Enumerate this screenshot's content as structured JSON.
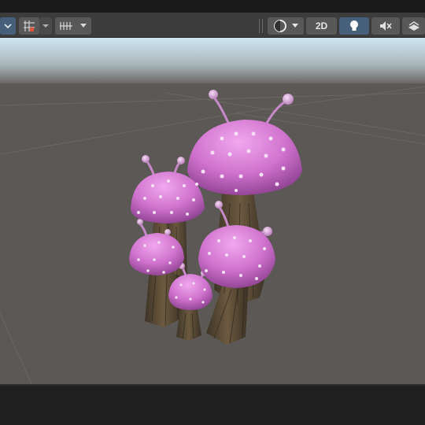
{
  "toolbar": {
    "two_d_label": "2D",
    "icons": {
      "draw_mode": "view-mode-dropdown-icon",
      "gizmo_grid": "grid-snap-icon",
      "visibility": "visibility-icon",
      "shading": "shading-sphere-icon",
      "lighting": "lightbulb-icon",
      "audio": "audio-mute-icon",
      "effects": "scene-effects-icon"
    },
    "lighting_active": true,
    "accent_color": "#46607c"
  },
  "scene": {
    "object": "mushroom-cluster",
    "mushroom_count": 5,
    "cap_color": "#d77fd6",
    "stem_color": "#5a4a35",
    "ground_color": "#5c5855",
    "sky_color": "#cfe4ef"
  }
}
